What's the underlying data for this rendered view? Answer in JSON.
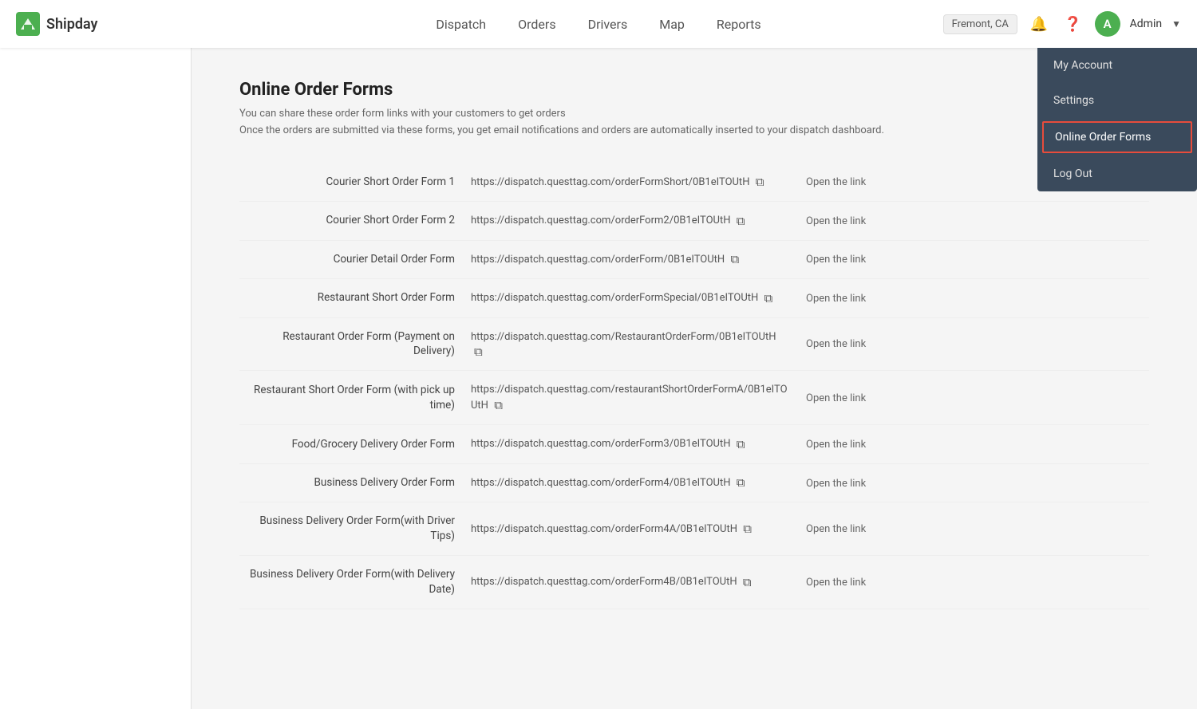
{
  "header": {
    "logo_text": "Shipday",
    "nav": [
      {
        "label": "Dispatch",
        "key": "dispatch"
      },
      {
        "label": "Orders",
        "key": "orders"
      },
      {
        "label": "Drivers",
        "key": "drivers"
      },
      {
        "label": "Map",
        "key": "map"
      },
      {
        "label": "Reports",
        "key": "reports"
      }
    ],
    "location": "Fremont, CA",
    "avatar_letter": "A",
    "admin_label": "Admin"
  },
  "dropdown": {
    "items": [
      {
        "label": "My Account",
        "key": "my-account",
        "active": false
      },
      {
        "label": "Settings",
        "key": "settings",
        "active": false
      },
      {
        "label": "Online Order Forms",
        "key": "online-order-forms",
        "active": true
      },
      {
        "label": "Log Out",
        "key": "log-out",
        "active": false
      }
    ]
  },
  "main": {
    "title": "Online Order Forms",
    "description_line1": "You can share these order form links with your customers to get orders",
    "description_line2": "Once the orders are submitted via these forms, you get email notifications and orders are automatically inserted to your dispatch dashboard.",
    "forms": [
      {
        "name": "Courier Short Order Form 1",
        "url": "https://dispatch.questtag.com/orderFormShort/0B1eITOUtH",
        "open_label": "Open the link"
      },
      {
        "name": "Courier Short Order Form 2",
        "url": "https://dispatch.questtag.com/orderForm2/0B1eITOUtH",
        "open_label": "Open the link"
      },
      {
        "name": "Courier Detail Order Form",
        "url": "https://dispatch.questtag.com/orderForm/0B1eITOUtH",
        "open_label": "Open the link"
      },
      {
        "name": "Restaurant Short Order Form",
        "url": "https://dispatch.questtag.com/orderFormSpecial/0B1eITOUtH",
        "open_label": "Open the link"
      },
      {
        "name": "Restaurant Order Form (Payment on Delivery)",
        "url": "https://dispatch.questtag.com/RestaurantOrderForm/0B1eITOUtH",
        "open_label": "Open the link"
      },
      {
        "name": "Restaurant Short Order Form (with pick up time)",
        "url": "https://dispatch.questtag.com/restaurantShortOrderFormA/0B1eITOUtH",
        "open_label": "Open the link"
      },
      {
        "name": "Food/Grocery Delivery Order Form",
        "url": "https://dispatch.questtag.com/orderForm3/0B1eITOUtH",
        "open_label": "Open the link"
      },
      {
        "name": "Business Delivery Order Form",
        "url": "https://dispatch.questtag.com/orderForm4/0B1eITOUtH",
        "open_label": "Open the link"
      },
      {
        "name": "Business Delivery Order Form(with Driver Tips)",
        "url": "https://dispatch.questtag.com/orderForm4A/0B1eITOUtH",
        "open_label": "Open the link"
      },
      {
        "name": "Business Delivery Order Form(with Delivery Date)",
        "url": "https://dispatch.questtag.com/orderForm4B/0B1eITOUtH",
        "open_label": "Open the link"
      }
    ]
  }
}
